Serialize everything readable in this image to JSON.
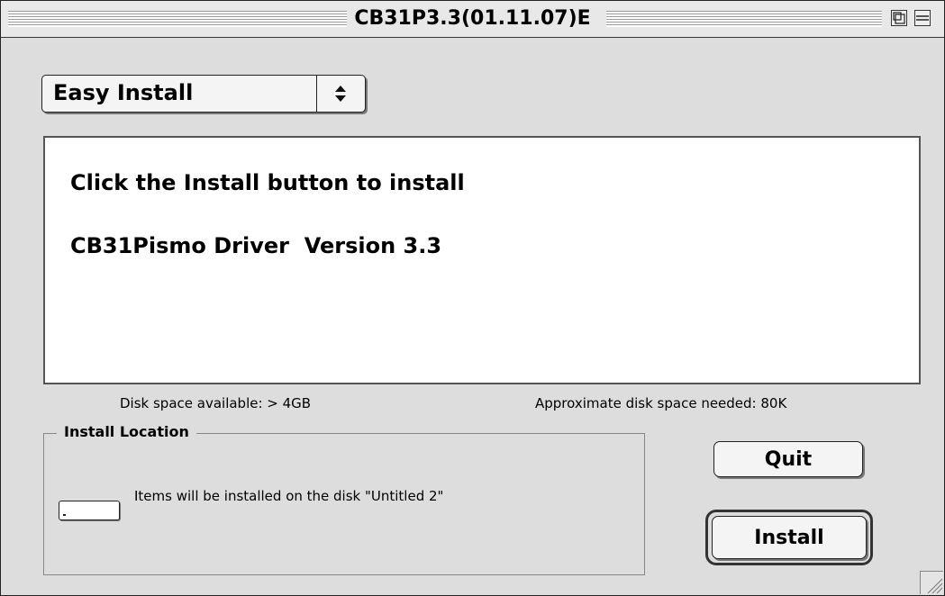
{
  "window": {
    "title": "CB31P3.3(01.11.07)E",
    "zoom_icon": "window-zoom-icon",
    "collapse_icon": "window-collapse-icon"
  },
  "install_mode": {
    "selected": "Easy Install",
    "arrow_icon": "updown-arrows-icon"
  },
  "info": {
    "line1": "Click the Install button to install",
    "line2": "CB31Pismo Driver  Version 3.3"
  },
  "disk_space": {
    "available": "Disk space available: > 4GB",
    "needed": "Approximate disk space needed: 80K"
  },
  "install_location": {
    "legend": "Install Location",
    "disk_icon": "disk-icon",
    "message": "Items will be installed on the disk \"Untitled 2\""
  },
  "buttons": {
    "quit": "Quit",
    "install": "Install"
  },
  "grow_box_icon": "resize-grip-icon"
}
